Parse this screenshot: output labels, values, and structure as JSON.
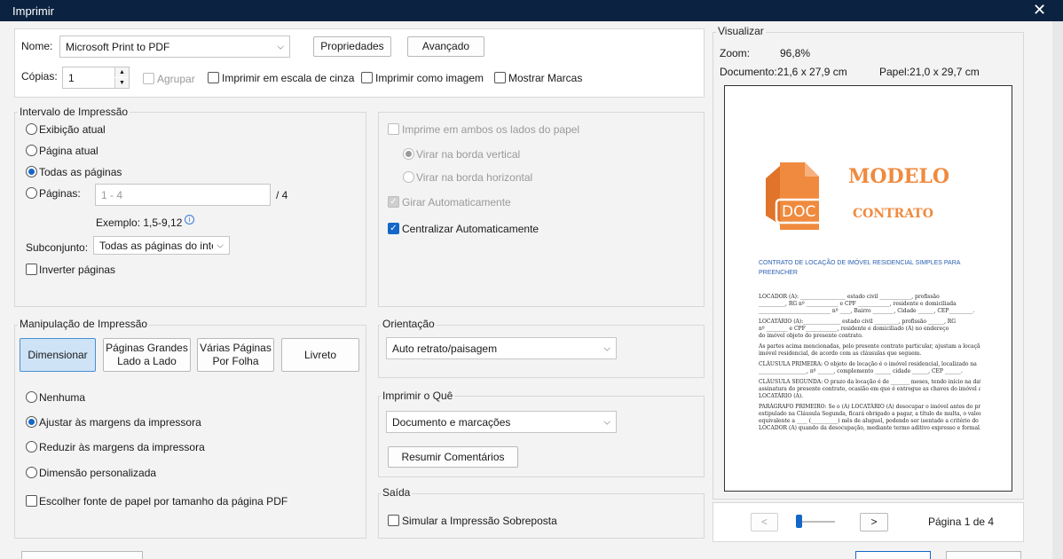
{
  "window": {
    "title": "Imprimir",
    "close_icon": "close-icon"
  },
  "printer": {
    "name_label": "Nome:",
    "name_value": "Microsoft Print to PDF",
    "properties_label": "Propriedades",
    "advanced_label": "Avançado",
    "copies_label": "Cópias:",
    "copies_value": "1",
    "collate_label": "Agrupar",
    "grayscale_label": "Imprimir em escala de cinza",
    "as_image_label": "Imprimir como imagem",
    "show_marks_label": "Mostrar Marcas"
  },
  "range": {
    "title": "Intervalo de Impressão",
    "current_view": "Exibição atual",
    "current_page": "Página atual",
    "all_pages": "Todas as páginas",
    "pages_label": "Páginas:",
    "pages_placeholder": "1 - 4",
    "pages_total": "/ 4",
    "example": "Exemplo: 1,5-9,12",
    "subset_label": "Subconjunto:",
    "subset_value": "Todas as páginas do interv",
    "reverse_label": "Inverter páginas"
  },
  "duplex": {
    "both_sides": "Imprime em ambos os lados do papel",
    "flip_long": "Virar na borda vertical",
    "flip_short": "Virar na borda horizontal",
    "auto_rotate": "Girar Automaticamente",
    "auto_center": "Centralizar Automaticamente"
  },
  "handling": {
    "title": "Manipulação de Impressão",
    "size": "Dimensionar",
    "poster_line1": "Páginas Grandes",
    "poster_line2": "Lado a Lado",
    "multiple_line1": "Várias Páginas",
    "multiple_line2": "Por Folha",
    "booklet": "Livreto",
    "none": "Nenhuma",
    "fit": "Ajustar às margens da impressora",
    "shrink": "Reduzir às margens da impressora",
    "custom": "Dimensão personalizada",
    "paper_source": "Escolher fonte de papel por tamanho da página PDF"
  },
  "orientation": {
    "title": "Orientação",
    "value": "Auto retrato/paisagem"
  },
  "what": {
    "title": "Imprimir o Quê",
    "value": "Documento e marcações",
    "summarize": "Resumir Comentários"
  },
  "output": {
    "title": "Saída",
    "simulate": "Simular a Impressão Sobreposta"
  },
  "preview": {
    "title": "Visualizar",
    "zoom_label": "Zoom:",
    "zoom_value": "96,8%",
    "doc_label": "Documento:",
    "doc_value": "21,6 x 27,9 cm",
    "paper_label": "Papel:",
    "paper_value": "21,0 x 29,7 cm",
    "prev": "<",
    "next": ">",
    "page_indicator": "Página 1 de 4"
  },
  "document": {
    "logo_text": "DOC",
    "title1": "MODELO",
    "title2": "CONTRATO",
    "heading1": "CONTRATO DE LOCAÇÃO DE IMÓVEL RESIDENCIAL SIMPLES PARA",
    "heading2": "PREENCHER",
    "lines": [
      "LOCADOR (A): _________________ estado civil ____________, profissão",
      "__________, RG nº ____________ e CPF ____________, residente e domiciliada",
      "___________________________ nº ____, Bairro ________, Cidade ______, CEP_________.",
      "LOCATÁRIO (A):______________ estado civil _________, profissão ______, RG",
      "nº ________ e CPF____________, residente e domiciliado (A) no endereço",
      "do imóvel objeto do presente contrato.",
      "As partes acima mencionadas, pelo presente contrato particular, ajustam a locação de um",
      "imóvel residencial, de acordo com as cláusulas que seguem.",
      "CLÁUSULA PRIMEIRA: O objeto de locação é o imóvel residencial, localizado na",
      "__________________, nº ______, complemento ______ cidade ______, CEP ______.",
      "CLÁUSULA SEGUNDA: O prazo da locação é de _______ meses, tendo início na data da",
      "assinatura do presente contrato, ocasião em que é entregue as chaves do imóvel ao (A)",
      "LOCATÁRIO (A).",
      "PARÁGRAFO PRIMEIRO: Se o (A) LOCATÁRIO (A) desocupar o imóvel antes do prazo",
      "estipulado na Cláusula Segunda, ficará obrigado a pagar, a título de multa, o valor",
      "equivalente a ____ (__________) mês de aluguel, podendo ser isentado a critério do (A)",
      "LOCADOR (A) quando da desocupação, mediante termo aditivo expresso e formal."
    ]
  },
  "colors": {
    "title_bar": "#0b2340",
    "accent": "#1467c8",
    "logo": "#f08a3e"
  }
}
